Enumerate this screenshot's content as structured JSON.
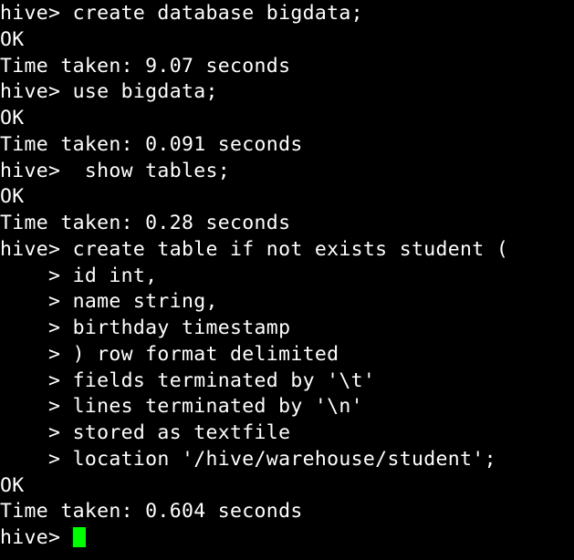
{
  "terminal": {
    "app": "hive-cli",
    "background_color": "#000000",
    "foreground_color": "#ffffff",
    "cursor_color": "#00ff00",
    "columns": 43,
    "rows": 21,
    "prompt": "hive>",
    "continuation_prompt": "    >",
    "cursor": {
      "glyph": "block-cursor",
      "line_index": 20,
      "column": 6
    },
    "lines": [
      {
        "index": 0,
        "kind": "command",
        "text": "hive> create database bigdata;"
      },
      {
        "index": 1,
        "kind": "status",
        "text": "OK"
      },
      {
        "index": 2,
        "kind": "timing",
        "text": "Time taken: 9.07 seconds"
      },
      {
        "index": 3,
        "kind": "command",
        "text": "hive> use bigdata;"
      },
      {
        "index": 4,
        "kind": "status",
        "text": "OK"
      },
      {
        "index": 5,
        "kind": "timing",
        "text": "Time taken: 0.091 seconds"
      },
      {
        "index": 6,
        "kind": "command",
        "text": "hive>  show tables;"
      },
      {
        "index": 7,
        "kind": "status",
        "text": "OK"
      },
      {
        "index": 8,
        "kind": "timing",
        "text": "Time taken: 0.28 seconds"
      },
      {
        "index": 9,
        "kind": "command",
        "text": "hive> create table if not exists student ("
      },
      {
        "index": 10,
        "kind": "continuation",
        "text": "    > id int,"
      },
      {
        "index": 11,
        "kind": "continuation",
        "text": "    > name string,"
      },
      {
        "index": 12,
        "kind": "continuation",
        "text": "    > birthday timestamp"
      },
      {
        "index": 13,
        "kind": "continuation",
        "text": "    > ) row format delimited"
      },
      {
        "index": 14,
        "kind": "continuation",
        "text": "    > fields terminated by '\\t'"
      },
      {
        "index": 15,
        "kind": "continuation",
        "text": "    > lines terminated by '\\n'"
      },
      {
        "index": 16,
        "kind": "continuation",
        "text": "    > stored as textfile"
      },
      {
        "index": 17,
        "kind": "continuation",
        "text": "    > location '/hive/warehouse/student';"
      },
      {
        "index": 18,
        "kind": "status",
        "text": "OK"
      },
      {
        "index": 19,
        "kind": "timing",
        "text": "Time taken: 0.604 seconds"
      },
      {
        "index": 20,
        "kind": "prompt",
        "text": "hive> "
      }
    ]
  }
}
